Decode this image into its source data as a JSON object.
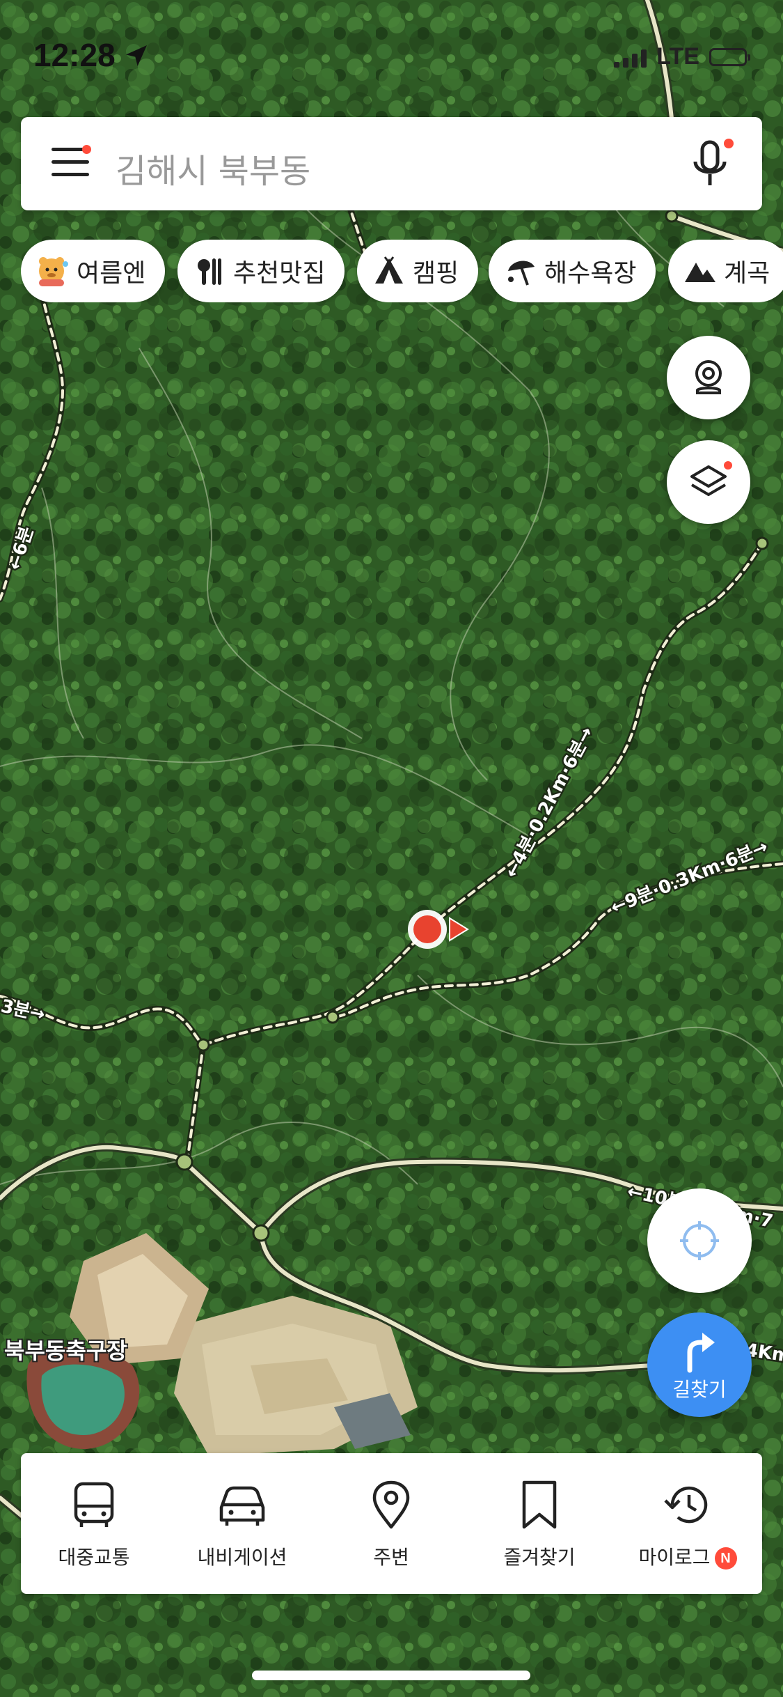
{
  "status_bar": {
    "time": "12:28",
    "network": "LTE"
  },
  "search": {
    "text": "김해시 북부동"
  },
  "chips": [
    {
      "label": "여름엔",
      "icon": "character-icon"
    },
    {
      "label": "추천맛집",
      "icon": "utensils-icon"
    },
    {
      "label": "캠핑",
      "icon": "tent-icon"
    },
    {
      "label": "해수욕장",
      "icon": "parasol-icon"
    },
    {
      "label": "계곡",
      "icon": "mountain-icon"
    }
  ],
  "map": {
    "place_label": "북부동축구장",
    "trail_labels": [
      "←4분·0.2Km·6분→",
      "←9분·0.3Km·6분→",
      "←6분",
      "3분→",
      "←10분·0.5Km·7",
      "4Km"
    ]
  },
  "route_button": {
    "label": "길찾기"
  },
  "bottom_nav": [
    {
      "label": "대중교통",
      "icon": "bus-icon"
    },
    {
      "label": "내비게이션",
      "icon": "car-icon"
    },
    {
      "label": "주변",
      "icon": "location-pin-icon"
    },
    {
      "label": "즐겨찾기",
      "icon": "bookmark-icon"
    },
    {
      "label": "마이로그",
      "icon": "history-icon",
      "badge": "N"
    }
  ],
  "colors": {
    "accent_blue": "#3d8ff3",
    "badge_red": "#ff4b3a",
    "marker_red": "#e8432f",
    "forest_green": "#2f5a25",
    "road_fill": "#e8e6c8"
  }
}
